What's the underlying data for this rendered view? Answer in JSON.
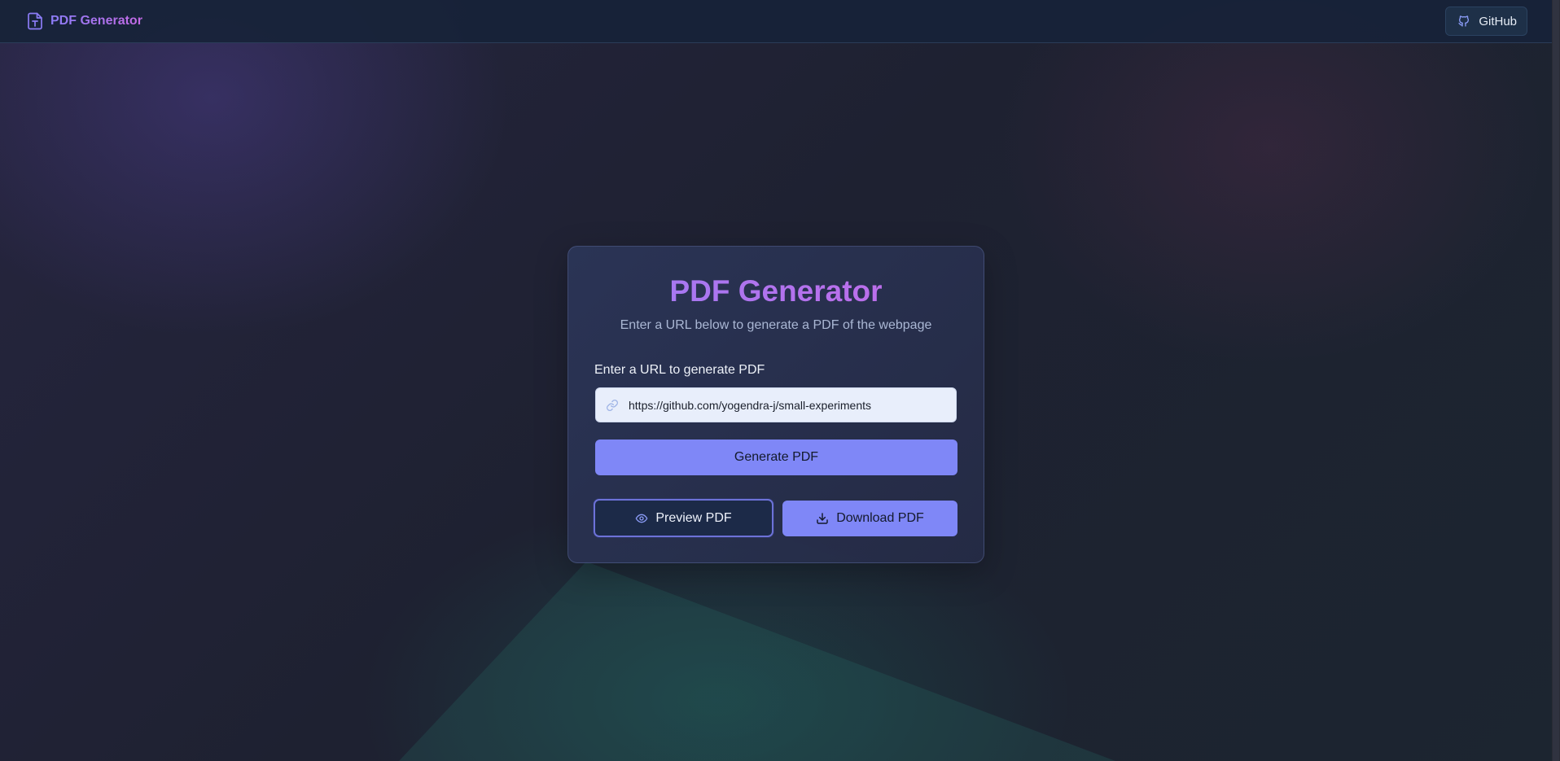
{
  "header": {
    "brand_title": "PDF Generator",
    "brand_icon": "file-type-icon",
    "github_label": "GitHub",
    "github_icon": "github-icon"
  },
  "card": {
    "title": "PDF Generator",
    "subtitle": "Enter a URL below to generate a PDF of the webpage",
    "field_label": "Enter a URL to generate PDF",
    "url_value": "https://github.com/yogendra-j/small-experiments",
    "url_icon": "link-icon",
    "generate_label": "Generate PDF",
    "preview_label": "Preview PDF",
    "preview_icon": "eye-icon",
    "download_label": "Download PDF",
    "download_icon": "download-icon"
  },
  "colors": {
    "accent": "#7f87f7",
    "brand_gradient_start": "#8b7cf6",
    "brand_gradient_end": "#c56ae6",
    "header_bg": "#172338",
    "page_bg": "#1e2234"
  }
}
